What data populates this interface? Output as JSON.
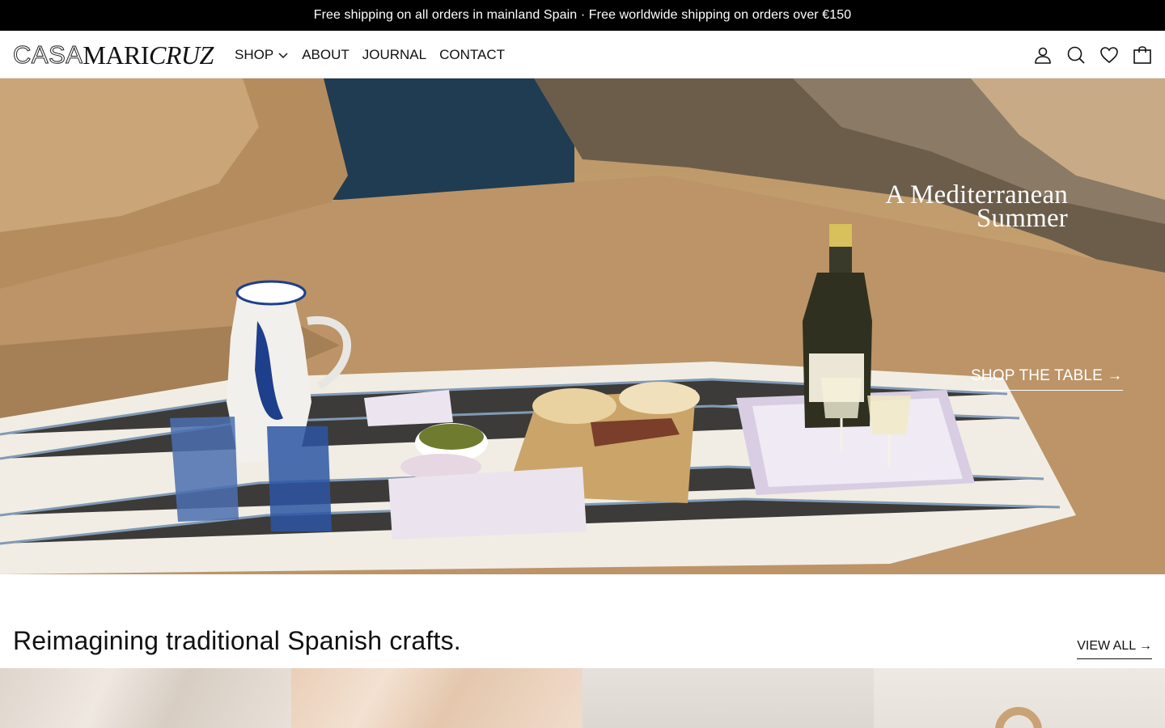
{
  "announcement": {
    "text": "Free shipping on all orders in mainland Spain · Free worldwide shipping on orders over €150"
  },
  "header": {
    "logo": {
      "part1": "CASA",
      "part2": "MARI",
      "part3": "CRUZ"
    },
    "nav": [
      {
        "label": "SHOP",
        "has_dropdown": true
      },
      {
        "label": "ABOUT"
      },
      {
        "label": "JOURNAL"
      },
      {
        "label": "CONTACT"
      }
    ],
    "icons": [
      "account-icon",
      "search-icon",
      "wishlist-heart-icon",
      "cart-bag-icon"
    ]
  },
  "hero": {
    "title_line1": "A Mediterranean",
    "title_line2": "Summer",
    "cta_label": "SHOP THE TABLE →"
  },
  "section": {
    "title": "Reimagining traditional Spanish crafts.",
    "view_all": "VIEW ALL →"
  },
  "colors": {
    "announcement_bg": "#000000",
    "text": "#111111",
    "hero_overlay_text": "#ffffff"
  }
}
